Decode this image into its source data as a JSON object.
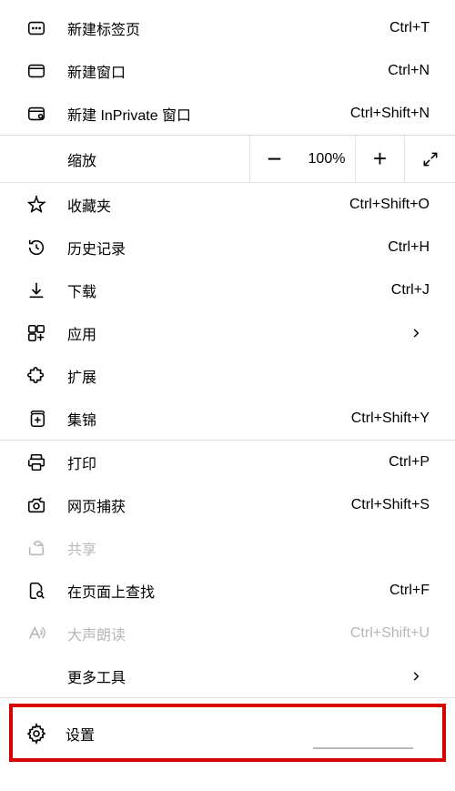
{
  "menu": {
    "newTab": {
      "label": "新建标签页",
      "shortcut": "Ctrl+T"
    },
    "newWindow": {
      "label": "新建窗口",
      "shortcut": "Ctrl+N"
    },
    "newInPrivate": {
      "label": "新建 InPrivate 窗口",
      "shortcut": "Ctrl+Shift+N"
    },
    "zoom": {
      "label": "缩放",
      "value": "100%"
    },
    "favorites": {
      "label": "收藏夹",
      "shortcut": "Ctrl+Shift+O"
    },
    "history": {
      "label": "历史记录",
      "shortcut": "Ctrl+H"
    },
    "downloads": {
      "label": "下载",
      "shortcut": "Ctrl+J"
    },
    "apps": {
      "label": "应用"
    },
    "extensions": {
      "label": "扩展"
    },
    "collections": {
      "label": "集锦",
      "shortcut": "Ctrl+Shift+Y"
    },
    "print": {
      "label": "打印",
      "shortcut": "Ctrl+P"
    },
    "webCapture": {
      "label": "网页捕获",
      "shortcut": "Ctrl+Shift+S"
    },
    "share": {
      "label": "共享"
    },
    "findOnPage": {
      "label": "在页面上查找",
      "shortcut": "Ctrl+F"
    },
    "readAloud": {
      "label": "大声朗读",
      "shortcut": "Ctrl+Shift+U"
    },
    "moreTools": {
      "label": "更多工具"
    },
    "settings": {
      "label": "设置"
    }
  }
}
